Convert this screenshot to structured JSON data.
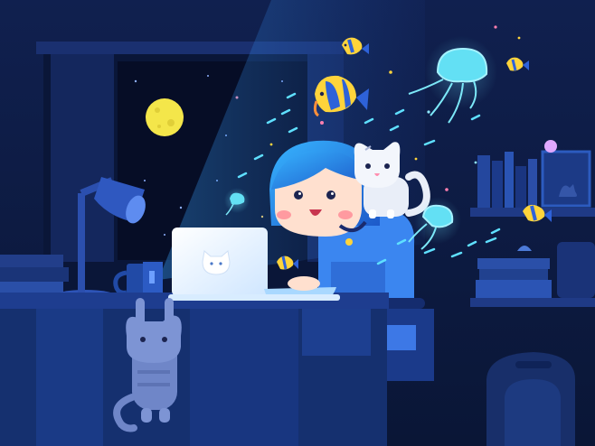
{
  "scene": {
    "subject": "girl-with-laptop-and-cats",
    "palette": {
      "night": "#0d1b4a",
      "room": "#13265f",
      "glow": "#3fd0ff",
      "moon": "#f4e64a",
      "hair": "#2a8fe0",
      "skin": "#ffe0cf",
      "cat": "#e9eef8",
      "cat_dark": "#4f6aa8",
      "desk": "#1e3d8f",
      "fish_yellow": "#ffd43b",
      "fish_blue": "#2e62d9"
    },
    "icons": [
      "moon-icon",
      "cat-logo-icon",
      "jellyfish-icon",
      "fish-icon",
      "desk-lamp-icon",
      "mug-icon",
      "backpack-icon"
    ]
  }
}
